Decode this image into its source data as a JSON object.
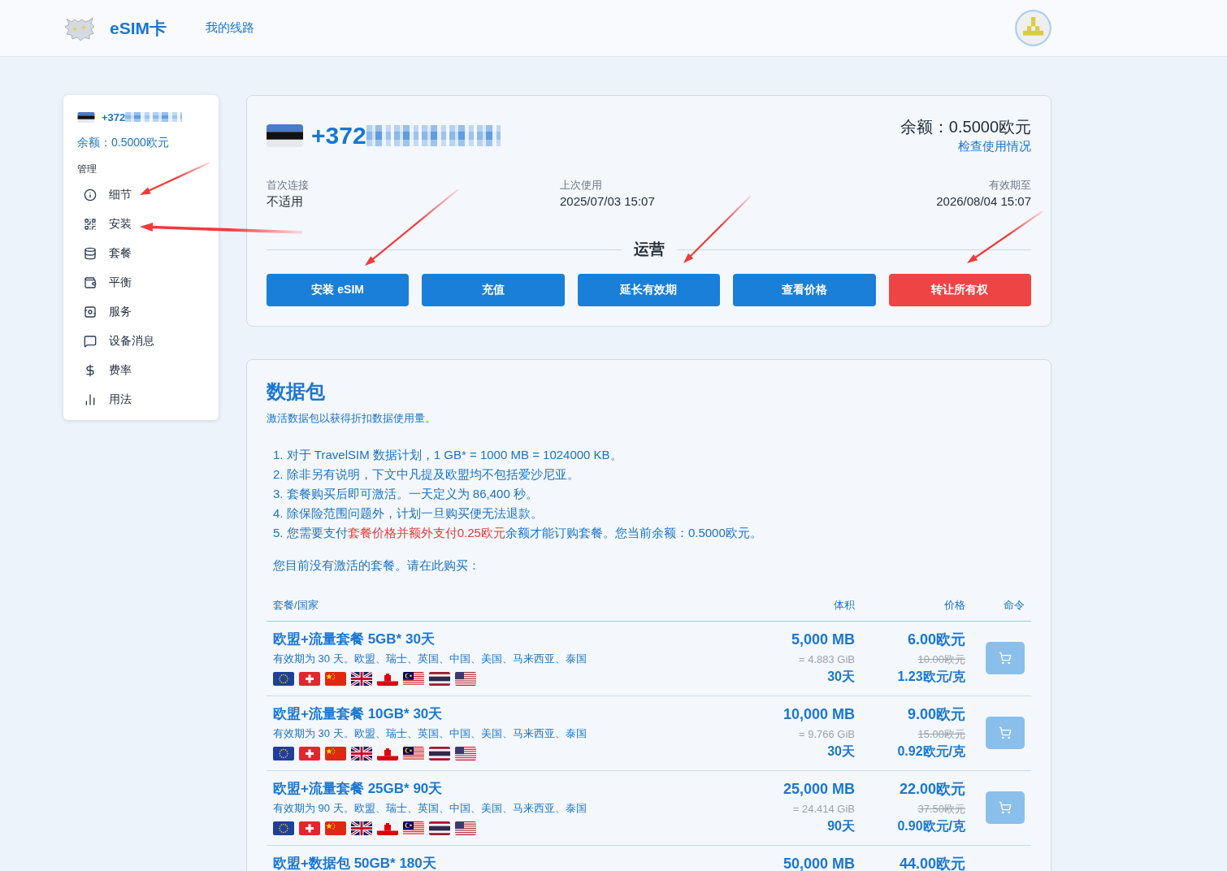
{
  "header": {
    "brand": "eSIM卡",
    "nav": [
      "我的线路"
    ]
  },
  "sidebar": {
    "phone_prefix": "+372",
    "balance": "余额：0.5000欧元",
    "section_title": "管理",
    "items": [
      "细节",
      "安装",
      "套餐",
      "平衡",
      "服务",
      "设备消息",
      "费率",
      "用法"
    ]
  },
  "line_card": {
    "phone_prefix": "+372",
    "balance": "余额：0.5000欧元",
    "usage_link": "检查使用情况",
    "fields": [
      {
        "label": "首次连接",
        "value": "不适用"
      },
      {
        "label": "上次使用",
        "value": "2025/07/03 15:07"
      },
      {
        "label": "有效期至",
        "value": "2026/08/04 15:07"
      }
    ],
    "operations_title": "运营",
    "buttons": [
      {
        "label": "安装 eSIM",
        "kind": "primary"
      },
      {
        "label": "充值",
        "kind": "primary"
      },
      {
        "label": "延长有效期",
        "kind": "primary"
      },
      {
        "label": "查看价格",
        "kind": "primary"
      },
      {
        "label": "转让所有权",
        "kind": "danger"
      }
    ]
  },
  "packages": {
    "title": "数据包",
    "subtitle": "激活数据包以获得折扣数据使用量。",
    "notes": [
      {
        "marker": "1.",
        "parts": [
          {
            "text": "对于 TravelSIM 数据计划，1 GB* = 1000 MB = 1024000 KB。",
            "highlight": false
          }
        ]
      },
      {
        "marker": "2.",
        "parts": [
          {
            "text": "除非另有说明，下文中凡提及欧盟均不包括爱沙尼亚。",
            "highlight": false
          }
        ]
      },
      {
        "marker": "3.",
        "parts": [
          {
            "text": "套餐购买后即可激活。一天定义为 86,400 秒。",
            "highlight": false
          }
        ]
      },
      {
        "marker": "4.",
        "parts": [
          {
            "text": "除保险范围问题外，计划一旦购买便无法退款。",
            "highlight": false
          }
        ]
      },
      {
        "marker": "5.",
        "parts": [
          {
            "text": "您需要支付",
            "highlight": false
          },
          {
            "text": "套餐价格并额外支付0.25欧元",
            "highlight": true
          },
          {
            "text": "余额才能订购套餐。您当前余额：0.5000欧元。",
            "highlight": false
          }
        ]
      }
    ],
    "status": "您目前没有激活的套餐。请在此购买：",
    "table": {
      "columns": [
        "套餐/国家",
        "体积",
        "价格",
        "命令"
      ],
      "rows": [
        {
          "name": "欧盟+流量套餐 5GB* 30天",
          "description": "有效期为 30 天。欧盟、瑞士、英国、中国、美国、马来西亚、泰国",
          "volume": "5,000 MB",
          "volume_gib": "= 4.883 GiB",
          "duration": "30天",
          "price": "6.00欧元",
          "old_price": "10.00欧元",
          "unit_price": "1.23欧元/克"
        },
        {
          "name": "欧盟+流量套餐 10GB* 30天",
          "description": "有效期为 30 天。欧盟、瑞士、英国、中国、美国、马来西亚、泰国",
          "volume": "10,000 MB",
          "volume_gib": "= 9.766 GiB",
          "duration": "30天",
          "price": "9.00欧元",
          "old_price": "15.00欧元",
          "unit_price": "0.92欧元/克"
        },
        {
          "name": "欧盟+流量套餐 25GB* 90天",
          "description": "有效期为 90 天。欧盟、瑞士、英国、中国、美国、马来西亚、泰国",
          "volume": "25,000 MB",
          "volume_gib": "= 24.414 GiB",
          "duration": "90天",
          "price": "22.00欧元",
          "old_price": "37.50欧元",
          "unit_price": "0.90欧元/克"
        },
        {
          "name": "欧盟+数据包 50GB* 180天",
          "volume": "50,000 MB",
          "price": "44.00欧元"
        }
      ]
    }
  }
}
